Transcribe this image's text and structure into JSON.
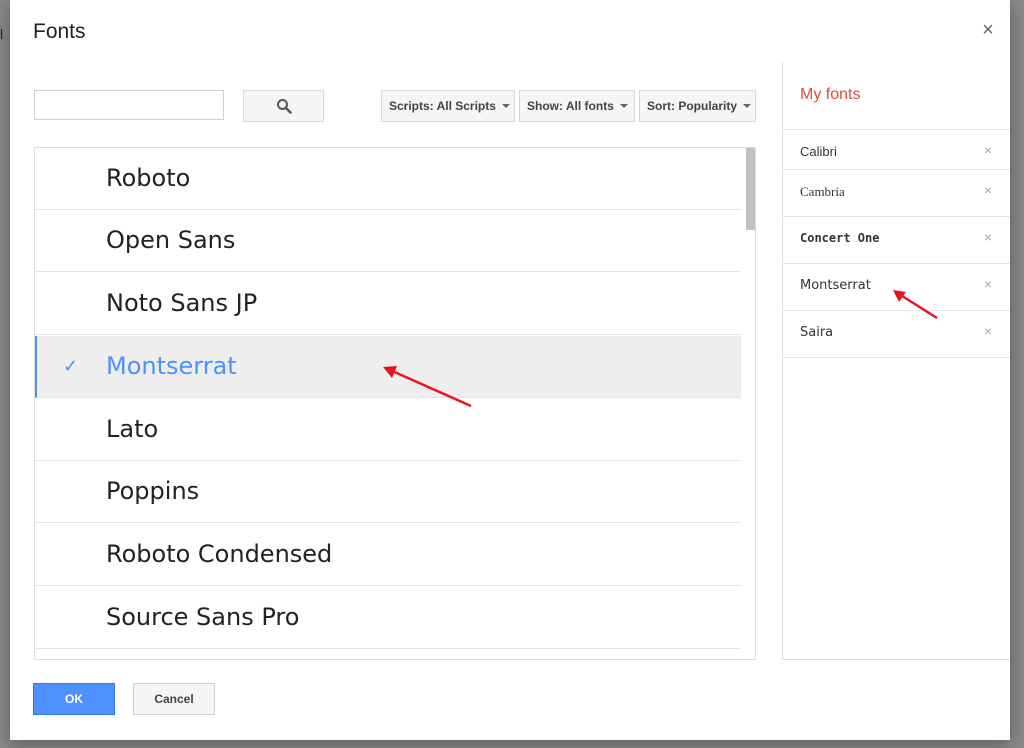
{
  "dialog": {
    "title": "Fonts"
  },
  "search": {
    "value": "",
    "placeholder": ""
  },
  "filters": {
    "scripts": "Scripts: All Scripts",
    "show": "Show: All fonts",
    "sort": "Sort: Popularity"
  },
  "font_list": [
    {
      "label": "Roboto",
      "selected": false
    },
    {
      "label": "Open Sans",
      "selected": false
    },
    {
      "label": "Noto Sans JP",
      "selected": false
    },
    {
      "label": "Montserrat",
      "selected": true
    },
    {
      "label": "Lato",
      "selected": false
    },
    {
      "label": "Poppins",
      "selected": false
    },
    {
      "label": "Roboto Condensed",
      "selected": false
    },
    {
      "label": "Source Sans Pro",
      "selected": false
    }
  ],
  "my_fonts": {
    "title": "My fonts",
    "items": [
      {
        "label": "Calibri"
      },
      {
        "label": "Cambria"
      },
      {
        "label": "Concert One"
      },
      {
        "label": "Montserrat"
      },
      {
        "label": "Saira"
      }
    ]
  },
  "buttons": {
    "ok": "OK",
    "cancel": "Cancel",
    "close": "×",
    "remove": "×",
    "check": "✓"
  },
  "colors": {
    "accent": "#4d90fe",
    "my_fonts_title": "#dd4b39",
    "annotation_arrow": "#e8141c"
  }
}
